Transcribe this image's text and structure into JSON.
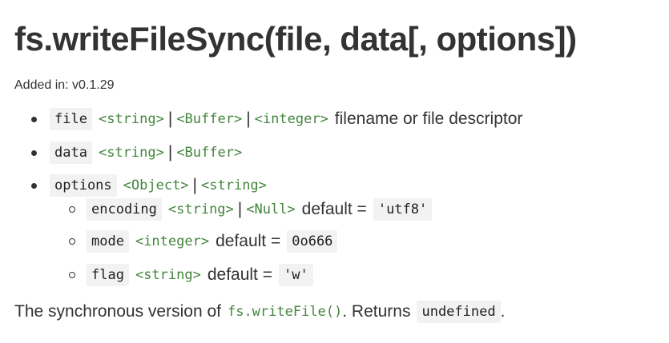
{
  "heading": {
    "title": "fs.writeFileSync(file, data[, options])",
    "added": "Added in: v0.1.29"
  },
  "params": [
    {
      "name": "file",
      "types": [
        "<string>",
        "<Buffer>",
        "<integer>"
      ],
      "description": "filename or file descriptor"
    },
    {
      "name": "data",
      "types": [
        "<string>",
        "<Buffer>"
      ]
    },
    {
      "name": "options",
      "types": [
        "<Object>",
        "<string>"
      ],
      "children": [
        {
          "name": "encoding",
          "types": [
            "<string>",
            "<Null>"
          ],
          "default_label": "default =",
          "default_value": "'utf8'"
        },
        {
          "name": "mode",
          "types": [
            "<integer>"
          ],
          "default_label": "default =",
          "default_value": "0o666"
        },
        {
          "name": "flag",
          "types": [
            "<string>"
          ],
          "default_label": "default =",
          "default_value": "'w'"
        }
      ]
    }
  ],
  "separator": "|",
  "description": {
    "before": "The synchronous version of",
    "link": "fs.writeFile()",
    "middle": ". Returns",
    "returns": "undefined",
    "after": "."
  }
}
